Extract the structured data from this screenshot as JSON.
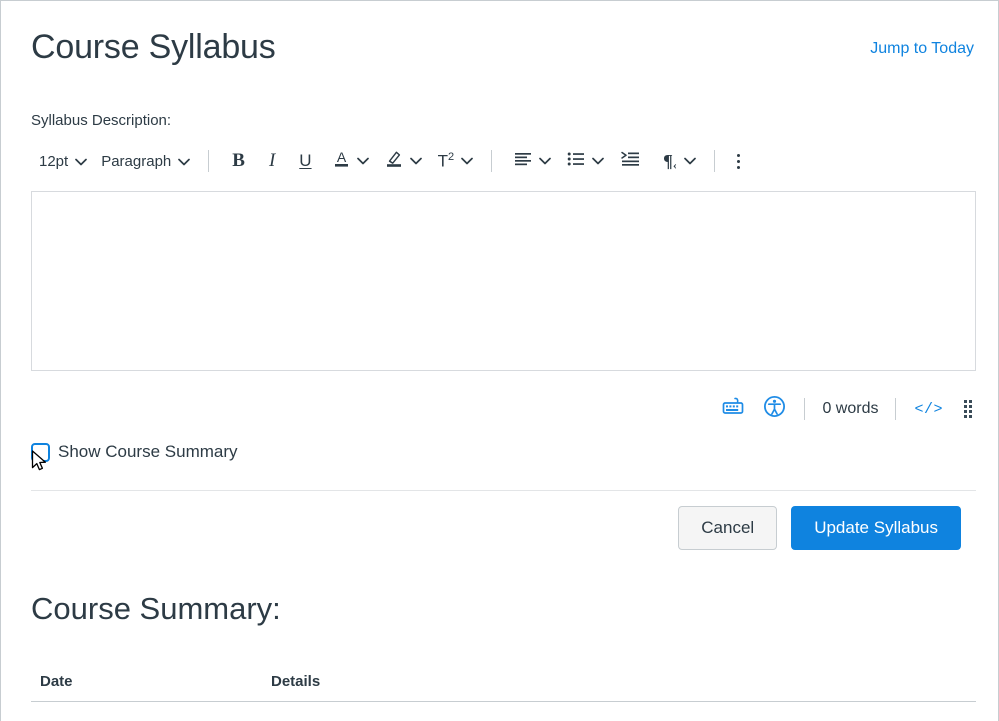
{
  "header": {
    "title": "Course Syllabus",
    "jump_link": "Jump to Today"
  },
  "description": {
    "label": "Syllabus Description:"
  },
  "editor": {
    "toolbar": {
      "font_size": "12pt",
      "block_format": "Paragraph",
      "bold_label": "B",
      "italic_label": "I",
      "underline_label": "U",
      "text_color_label": "A",
      "highlight_label": "highlighter-icon",
      "superscript_label": "T",
      "superscript_exponent": "2",
      "align_label": "align-left-icon",
      "list_label": "bulleted-list-icon",
      "indent_label": "indent-icon",
      "direction_label": "¶",
      "direction_arrow": "‹",
      "more_label": "more-options-icon",
      "caret": "⌄"
    },
    "content": "",
    "status": {
      "keyboard_icon": "keyboard-shortcuts-icon",
      "accessibility_icon": "accessibility-checker-icon",
      "word_count": "0 words",
      "html_editor_label": "</>",
      "resize_handle": "resize-handle-icon"
    }
  },
  "show_summary": {
    "label": "Show Course Summary",
    "checked": false
  },
  "actions": {
    "cancel_label": "Cancel",
    "submit_label": "Update Syllabus"
  },
  "course_summary": {
    "title": "Course Summary:",
    "columns": [
      "Date",
      "Details"
    ],
    "rows": []
  },
  "colors": {
    "brand": "#0f83df",
    "text": "#2d3b45",
    "border": "#c7cdd1"
  }
}
